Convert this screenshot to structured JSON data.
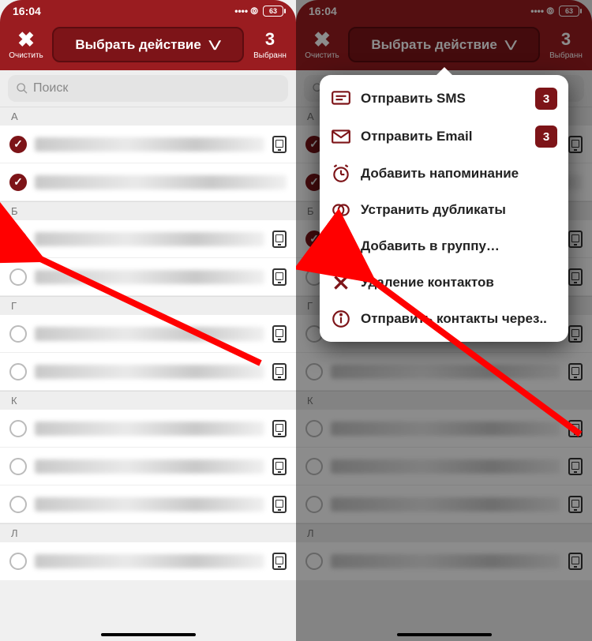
{
  "status": {
    "time": "16:04",
    "battery": "63"
  },
  "header": {
    "clear_label": "Очистить",
    "action_label": "Выбрать действие",
    "count": "3",
    "count_label": "Выбранн"
  },
  "search": {
    "placeholder": "Поиск"
  },
  "sections": {
    "0": {
      "letter": "А"
    },
    "1": {
      "letter": "Б"
    },
    "2": {
      "letter": "Г"
    },
    "3": {
      "letter": "К"
    },
    "4": {
      "letter": "Л"
    }
  },
  "menu": {
    "0": {
      "label": "Отправить SMS",
      "badge": "3"
    },
    "1": {
      "label": "Отправить Email",
      "badge": "3"
    },
    "2": {
      "label": "Добавить напоминание"
    },
    "3": {
      "label": "Устранить дубликаты"
    },
    "4": {
      "label": "Добавить в группу…"
    },
    "5": {
      "label": "Удаление контактов"
    },
    "6": {
      "label": "Отправить контакты через.."
    }
  }
}
